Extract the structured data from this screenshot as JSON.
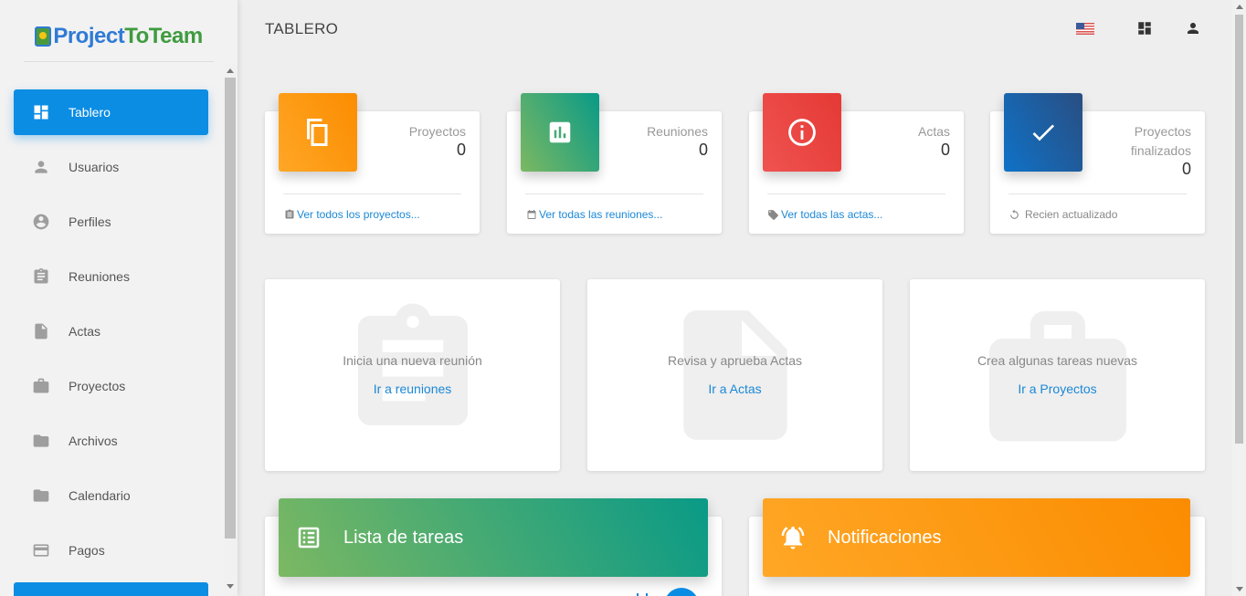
{
  "app": {
    "logo_text_part1": "Project",
    "logo_text_part2": "ToTeam",
    "page_title": "TABLERO",
    "accent_color": "#0b8de4"
  },
  "header": {
    "icons": [
      "us-flag-icon",
      "dashboard-icon",
      "user-icon"
    ]
  },
  "sidebar": {
    "items": [
      {
        "label": "Tablero",
        "icon": "dashboard-icon",
        "active": true
      },
      {
        "label": "Usuarios",
        "icon": "person-icon",
        "active": false
      },
      {
        "label": "Perfiles",
        "icon": "account-circle-icon",
        "active": false
      },
      {
        "label": "Reuniones",
        "icon": "clipboard-icon",
        "active": false
      },
      {
        "label": "Actas",
        "icon": "document-icon",
        "active": false
      },
      {
        "label": "Proyectos",
        "icon": "briefcase-icon",
        "active": false
      },
      {
        "label": "Archivos",
        "icon": "folder-icon",
        "active": false
      },
      {
        "label": "Calendario",
        "icon": "folder-icon",
        "active": false
      },
      {
        "label": "Pagos",
        "icon": "credit-card-icon",
        "active": false
      }
    ]
  },
  "stats": [
    {
      "label": "Proyectos",
      "value": "0",
      "footer": "Ver todos los proyectos...",
      "icon": "copy-icon",
      "color": "#fb8c00"
    },
    {
      "label": "Reuniones",
      "value": "0",
      "footer": "Ver todas las reuniones...",
      "icon": "bar-chart-icon",
      "color": "#099a87"
    },
    {
      "label": "Actas",
      "value": "0",
      "footer": "Ver todas las actas...",
      "icon": "info-icon",
      "color": "#e53935"
    },
    {
      "label_line1": "Proyectos",
      "label_line2": "finalizados",
      "value": "0",
      "footer": "Recien actualizado",
      "icon": "check-icon",
      "color": "#0f72c7"
    }
  ],
  "actions": [
    {
      "text": "Inicia una nueva reunión",
      "link": "Ir a reuniones",
      "icon": "clipboard-icon"
    },
    {
      "text": "Revisa y aprueba Actas",
      "link": "Ir a Actas",
      "icon": "document-icon"
    },
    {
      "text": "Crea algunas tareas nuevas",
      "link": "Ir a Proyectos",
      "icon": "briefcase-icon"
    }
  ],
  "panels": {
    "tasks_title": "Lista de tareas",
    "notifications_title": "Notificaciones"
  }
}
